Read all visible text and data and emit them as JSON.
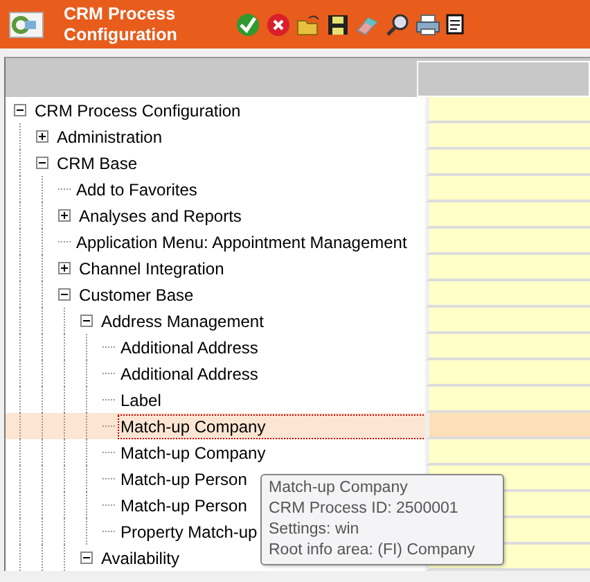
{
  "header": {
    "title_line_1": "CRM Process",
    "title_line_2": "Configuration"
  },
  "tree": [
    {
      "label": "CRM Process Configuration",
      "kind": "folder",
      "expanded": true,
      "selected": false,
      "children": [
        {
          "label": "Administration",
          "kind": "folder",
          "expanded": false,
          "selected": false
        },
        {
          "label": "CRM Base",
          "kind": "folder",
          "expanded": true,
          "selected": false,
          "children": [
            {
              "label": "Add to Favorites",
              "kind": "leaf",
              "selected": false
            },
            {
              "label": "Analyses and Reports",
              "kind": "folder",
              "expanded": false,
              "selected": false
            },
            {
              "label": "Application Menu: Appointment Management",
              "kind": "leaf",
              "selected": false
            },
            {
              "label": "Channel Integration",
              "kind": "folder",
              "expanded": false,
              "selected": false
            },
            {
              "label": "Customer Base",
              "kind": "folder",
              "expanded": true,
              "selected": false,
              "children": [
                {
                  "label": "Address Management",
                  "kind": "folder",
                  "expanded": true,
                  "selected": false,
                  "children": [
                    {
                      "label": "Additional Address",
                      "kind": "leaf",
                      "selected": false
                    },
                    {
                      "label": "Additional Address",
                      "kind": "leaf",
                      "selected": false
                    },
                    {
                      "label": "Label",
                      "kind": "leaf",
                      "selected": false
                    },
                    {
                      "label": "Match-up Company",
                      "kind": "leaf",
                      "selected": true
                    },
                    {
                      "label": "Match-up Company",
                      "kind": "leaf",
                      "selected": false
                    },
                    {
                      "label": "Match-up Person",
                      "kind": "leaf",
                      "selected": false
                    },
                    {
                      "label": "Match-up Person",
                      "kind": "leaf",
                      "selected": false
                    },
                    {
                      "label": "Property Match-up",
                      "kind": "leaf",
                      "selected": false
                    }
                  ]
                },
                {
                  "label": "Availability",
                  "kind": "folder",
                  "expanded": true,
                  "selected": false
                }
              ]
            }
          ]
        }
      ]
    }
  ],
  "tooltip": {
    "lines": [
      "Match-up Company",
      "CRM Process ID: 2500001",
      "Settings: win",
      "Root info area: (FI) Company"
    ]
  }
}
